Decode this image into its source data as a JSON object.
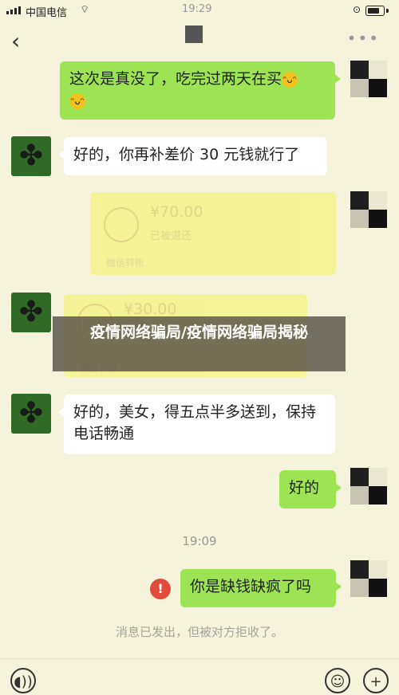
{
  "status_bar": {
    "carrier": "中国电信",
    "time": "19:29"
  },
  "nav": {
    "back": "‹",
    "more": "•••"
  },
  "messages": [
    {
      "text": "这次是真没了，吃完过两天在买",
      "emoji": "😁"
    },
    {
      "text": "好的，你再补差价 30 元钱就行了"
    },
    {
      "transfer_amount": "¥70.00",
      "transfer_status": "已被退还",
      "transfer_foot": "微信转账"
    },
    {
      "transfer_amount": "¥30.00",
      "transfer_foot": "微信转账"
    },
    {
      "text": "好的，美女，得五点半多送到，保持电话畅通"
    },
    {
      "text": "好的"
    },
    {
      "text": "你是缺钱缺疯了吗"
    }
  ],
  "timestamp": "19:09",
  "system_notice": "消息已发出，但被对方拒收了。",
  "banner": {
    "title": "疫情网络骗局/疫情网络骗局揭秘"
  },
  "error_mark": "!",
  "icons": {
    "voice": "voice-icon",
    "emoji": "emoji-icon",
    "plus": "plus-icon"
  }
}
